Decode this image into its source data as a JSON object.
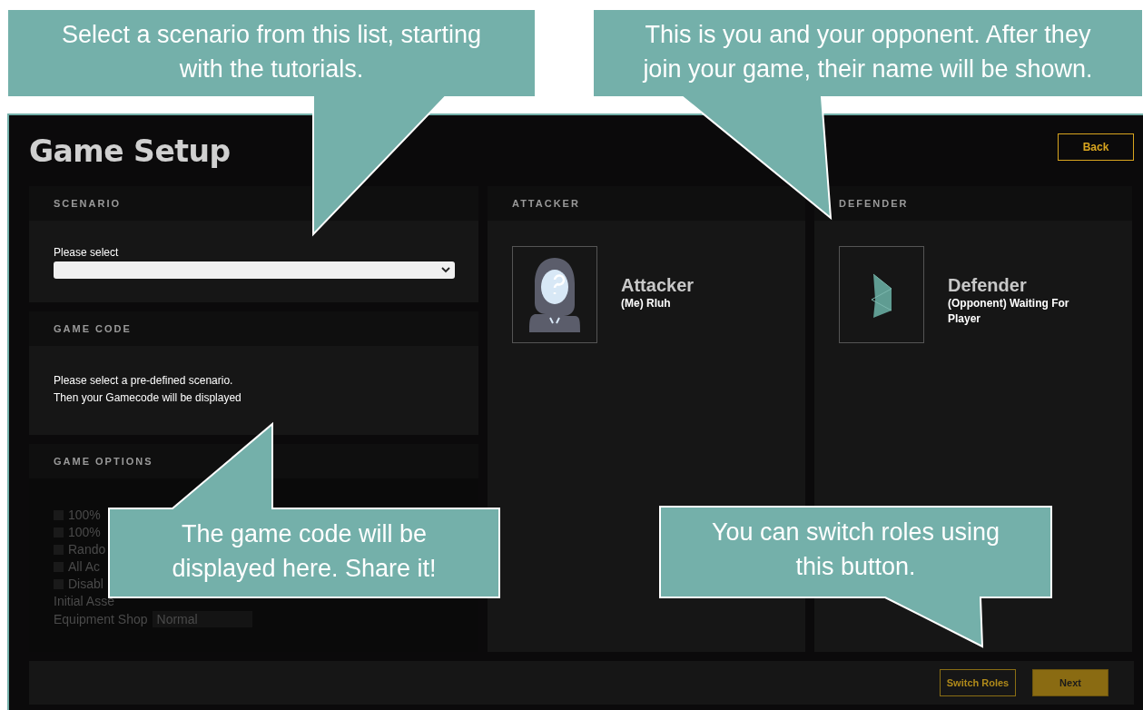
{
  "window": {
    "title": "Game Setup",
    "back_button": "Back"
  },
  "scenario": {
    "heading": "SCENARIO",
    "label": "Please select"
  },
  "game_code": {
    "heading": "GAME CODE",
    "lines": [
      "Please select a pre-defined scenario.",
      "Then your Gamecode will be displayed"
    ]
  },
  "game_options": {
    "heading": "GAME OPTIONS",
    "checkboxes": [
      {
        "label": "100%",
        "checked": false
      },
      {
        "label": "100%",
        "checked": false
      },
      {
        "label": "Rando",
        "checked": false
      },
      {
        "label": "All Ac",
        "checked": false
      },
      {
        "label": "Disabl",
        "checked": false
      }
    ],
    "initial_label": "Initial Asse",
    "shop_label": "Equipment Shop",
    "shop_value": "Normal"
  },
  "players": [
    {
      "heading": "ATTACKER",
      "role": "Attacker",
      "name": "(Me) Rluh",
      "kind": "hooded"
    },
    {
      "heading": "DEFENDER",
      "role": "Defender",
      "name": "(Opponent) Waiting For Player",
      "kind": "shield"
    }
  ],
  "footer": {
    "buttons": [
      {
        "label": "Switch Roles",
        "kind": "outline"
      },
      {
        "label": "Next",
        "kind": "filled"
      }
    ]
  },
  "callouts": [
    {
      "text": "Select a scenario from this list, starting with the tutorials."
    },
    {
      "text": "This is you and your opponent. After they join your game, their name will be shown."
    },
    {
      "text": "The game code will be displayed here. Share it!"
    },
    {
      "text": "You can switch roles using this button."
    }
  ]
}
